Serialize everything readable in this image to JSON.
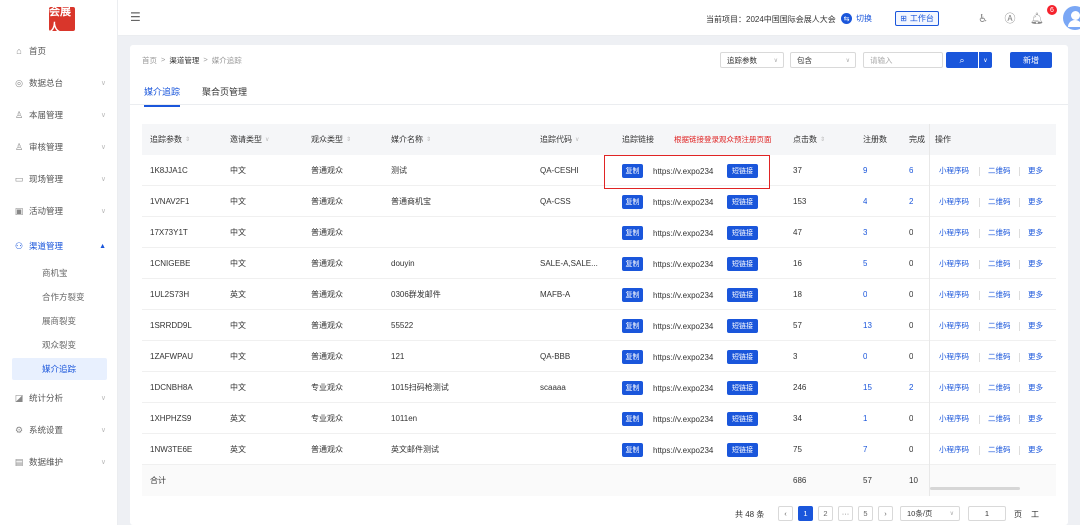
{
  "brand": {
    "logo_text": "会展人"
  },
  "topbar": {
    "project_label": "当前项目：2024中国国际会展人大会",
    "switch_label": "切换",
    "workbench_label": "工作台",
    "notification_count": "6"
  },
  "sidebar": {
    "items": [
      {
        "label": "首页",
        "icon": "home-icon",
        "glyph": "⌂"
      },
      {
        "label": "数据总台",
        "icon": "data-icon",
        "glyph": "◎"
      },
      {
        "label": "本届管理",
        "icon": "user-icon",
        "glyph": "♙"
      },
      {
        "label": "审核管理",
        "icon": "audit-icon",
        "glyph": "♙"
      },
      {
        "label": "现场管理",
        "icon": "screen-icon",
        "glyph": "▭"
      },
      {
        "label": "活动管理",
        "icon": "calendar-icon",
        "glyph": "▣"
      },
      {
        "label": "渠道管理",
        "icon": "channel-icon",
        "glyph": "⚇"
      },
      {
        "label": "统计分析",
        "icon": "chart-icon",
        "glyph": "◪"
      },
      {
        "label": "系统设置",
        "icon": "gear-icon",
        "glyph": "⚙"
      },
      {
        "label": "数据维护",
        "icon": "database-icon",
        "glyph": "▤"
      }
    ],
    "subitems": [
      "商机宝",
      "合作方裂变",
      "展商裂变",
      "观众裂变",
      "媒介追踪"
    ]
  },
  "breadcrumb": {
    "home": "首页",
    "sep": ">",
    "level1": "渠道管理",
    "current": "媒介追踪"
  },
  "tabs": [
    "媒介追踪",
    "聚合页管理"
  ],
  "search": {
    "field": "追踪参数",
    "operator": "包含",
    "placeholder": "请输入",
    "search_glyph": "⌕",
    "add_label": "新增"
  },
  "table": {
    "columns": [
      "追踪参数",
      "邀请类型",
      "观众类型",
      "媒介名称",
      "追踪代码",
      "追踪链接",
      "根据链接登录观众预注册页面",
      "点击数",
      "注册数",
      "完成",
      "操作"
    ],
    "copy_label": "复制",
    "short_label": "短链接",
    "ops": [
      "小程序码",
      "二维码",
      "更多"
    ],
    "rows": [
      {
        "param": "1K8JJA1C",
        "invite": "中文",
        "audience": "普通观众",
        "media": "测试",
        "code": "QA-CESHI",
        "url": "https://v.expo234",
        "clicks": "37",
        "regs": "9",
        "done": "6"
      },
      {
        "param": "1VNAV2F1",
        "invite": "中文",
        "audience": "普通观众",
        "media": "普通商机宝",
        "code": "QA-CSS",
        "url": "https://v.expo234",
        "clicks": "153",
        "regs": "4",
        "done": "2"
      },
      {
        "param": "17X73Y1T",
        "invite": "中文",
        "audience": "普通观众",
        "media": "",
        "code": "",
        "url": "https://v.expo234",
        "clicks": "47",
        "regs": "3",
        "done": "0"
      },
      {
        "param": "1CNIGEBE",
        "invite": "中文",
        "audience": "普通观众",
        "media": "douyin",
        "code": "SALE-A,SALE...",
        "url": "https://v.expo234",
        "clicks": "16",
        "regs": "5",
        "done": "0"
      },
      {
        "param": "1UL2S73H",
        "invite": "英文",
        "audience": "普通观众",
        "media": "0306群发邮件",
        "code": "MAFB-A",
        "url": "https://v.expo234",
        "clicks": "18",
        "regs": "0",
        "done": "0"
      },
      {
        "param": "1SRRDD9L",
        "invite": "中文",
        "audience": "普通观众",
        "media": "55522",
        "code": "",
        "url": "https://v.expo234",
        "clicks": "57",
        "regs": "13",
        "done": "0"
      },
      {
        "param": "1ZAFWPAU",
        "invite": "中文",
        "audience": "普通观众",
        "media": "121",
        "code": "QA-BBB",
        "url": "https://v.expo234",
        "clicks": "3",
        "regs": "0",
        "done": "0"
      },
      {
        "param": "1DCNBH8A",
        "invite": "中文",
        "audience": "专业观众",
        "media": "1015扫码枪测试",
        "code": "scaaaa",
        "url": "https://v.expo234",
        "clicks": "246",
        "regs": "15",
        "done": "2"
      },
      {
        "param": "1XHPHZS9",
        "invite": "英文",
        "audience": "专业观众",
        "media": "1011en",
        "code": "",
        "url": "https://v.expo234",
        "clicks": "34",
        "regs": "1",
        "done": "0"
      },
      {
        "param": "1NW3TE6E",
        "invite": "英文",
        "audience": "普通观众",
        "media": "英文邮件测试",
        "code": "",
        "url": "https://v.expo234",
        "clicks": "75",
        "regs": "7",
        "done": "0"
      }
    ],
    "summary": {
      "label": "合计",
      "clicks": "686",
      "regs": "57",
      "done": "10"
    }
  },
  "pagination": {
    "total": "共 48 条",
    "pages": [
      "1",
      "2",
      "···",
      "5"
    ],
    "current": "1",
    "page_size": "10条/页",
    "jump_value": "1",
    "page_suffix": "页",
    "extra": "工"
  },
  "colors": {
    "primary": "#1a56db",
    "danger": "#e02424"
  }
}
